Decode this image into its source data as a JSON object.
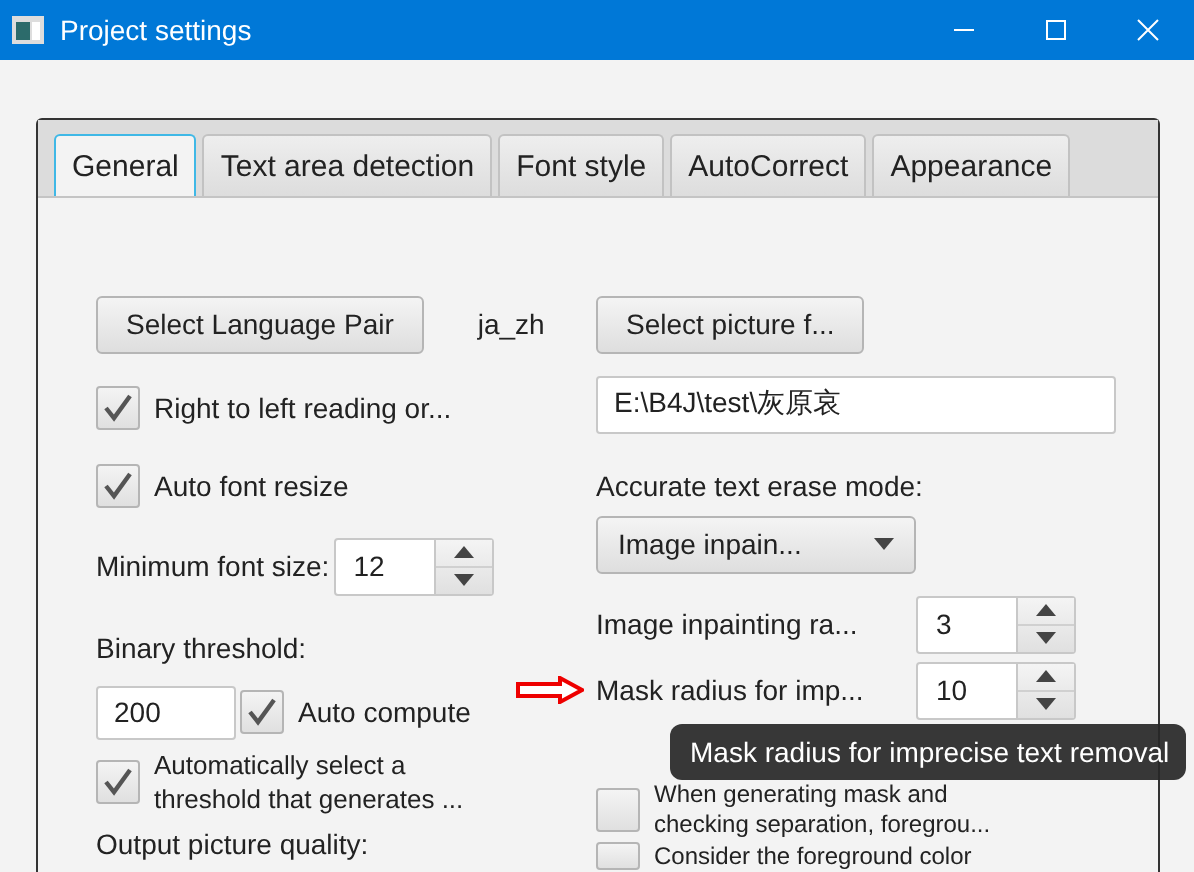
{
  "window": {
    "title": "Project settings"
  },
  "tabs": [
    {
      "label": "General",
      "selected": true
    },
    {
      "label": "Text area detection",
      "selected": false
    },
    {
      "label": "Font style",
      "selected": false
    },
    {
      "label": "AutoCorrect",
      "selected": false
    },
    {
      "label": "Appearance",
      "selected": false
    }
  ],
  "left": {
    "language_button": "Select Language Pair",
    "language_code": "ja_zh",
    "rtl": {
      "label": "Right to left reading or...",
      "checked": true
    },
    "auto_font_resize": {
      "label": "Auto font resize",
      "checked": true
    },
    "min_font_size": {
      "label": "Minimum font size:",
      "value": "12"
    },
    "binary_threshold_label": "Binary threshold:",
    "binary_threshold_value": "200",
    "auto_compute": {
      "label": "Auto compute",
      "checked": true
    },
    "auto_select": {
      "label_lines": [
        "Automatically select a",
        "threshold that generates ..."
      ],
      "checked": true
    },
    "output_quality_label": "Output picture quality:"
  },
  "right": {
    "picture_button": "Select picture f...",
    "path": "E:\\B4J\\test\\灰原哀",
    "erase_mode_label": "Accurate text erase mode:",
    "erase_mode": "Image inpain...",
    "inpainting": {
      "label": "Image inpainting ra...",
      "value": "3"
    },
    "mask": {
      "label": "Mask radius for imp...",
      "value": "10"
    },
    "separation": {
      "label_lines": [
        "When generating mask and",
        "checking separation, foregrou..."
      ],
      "checked": false
    },
    "foreground": {
      "label": "Consider the foreground color",
      "checked": false
    }
  },
  "tooltip": "Mask radius for imprecise text removal"
}
